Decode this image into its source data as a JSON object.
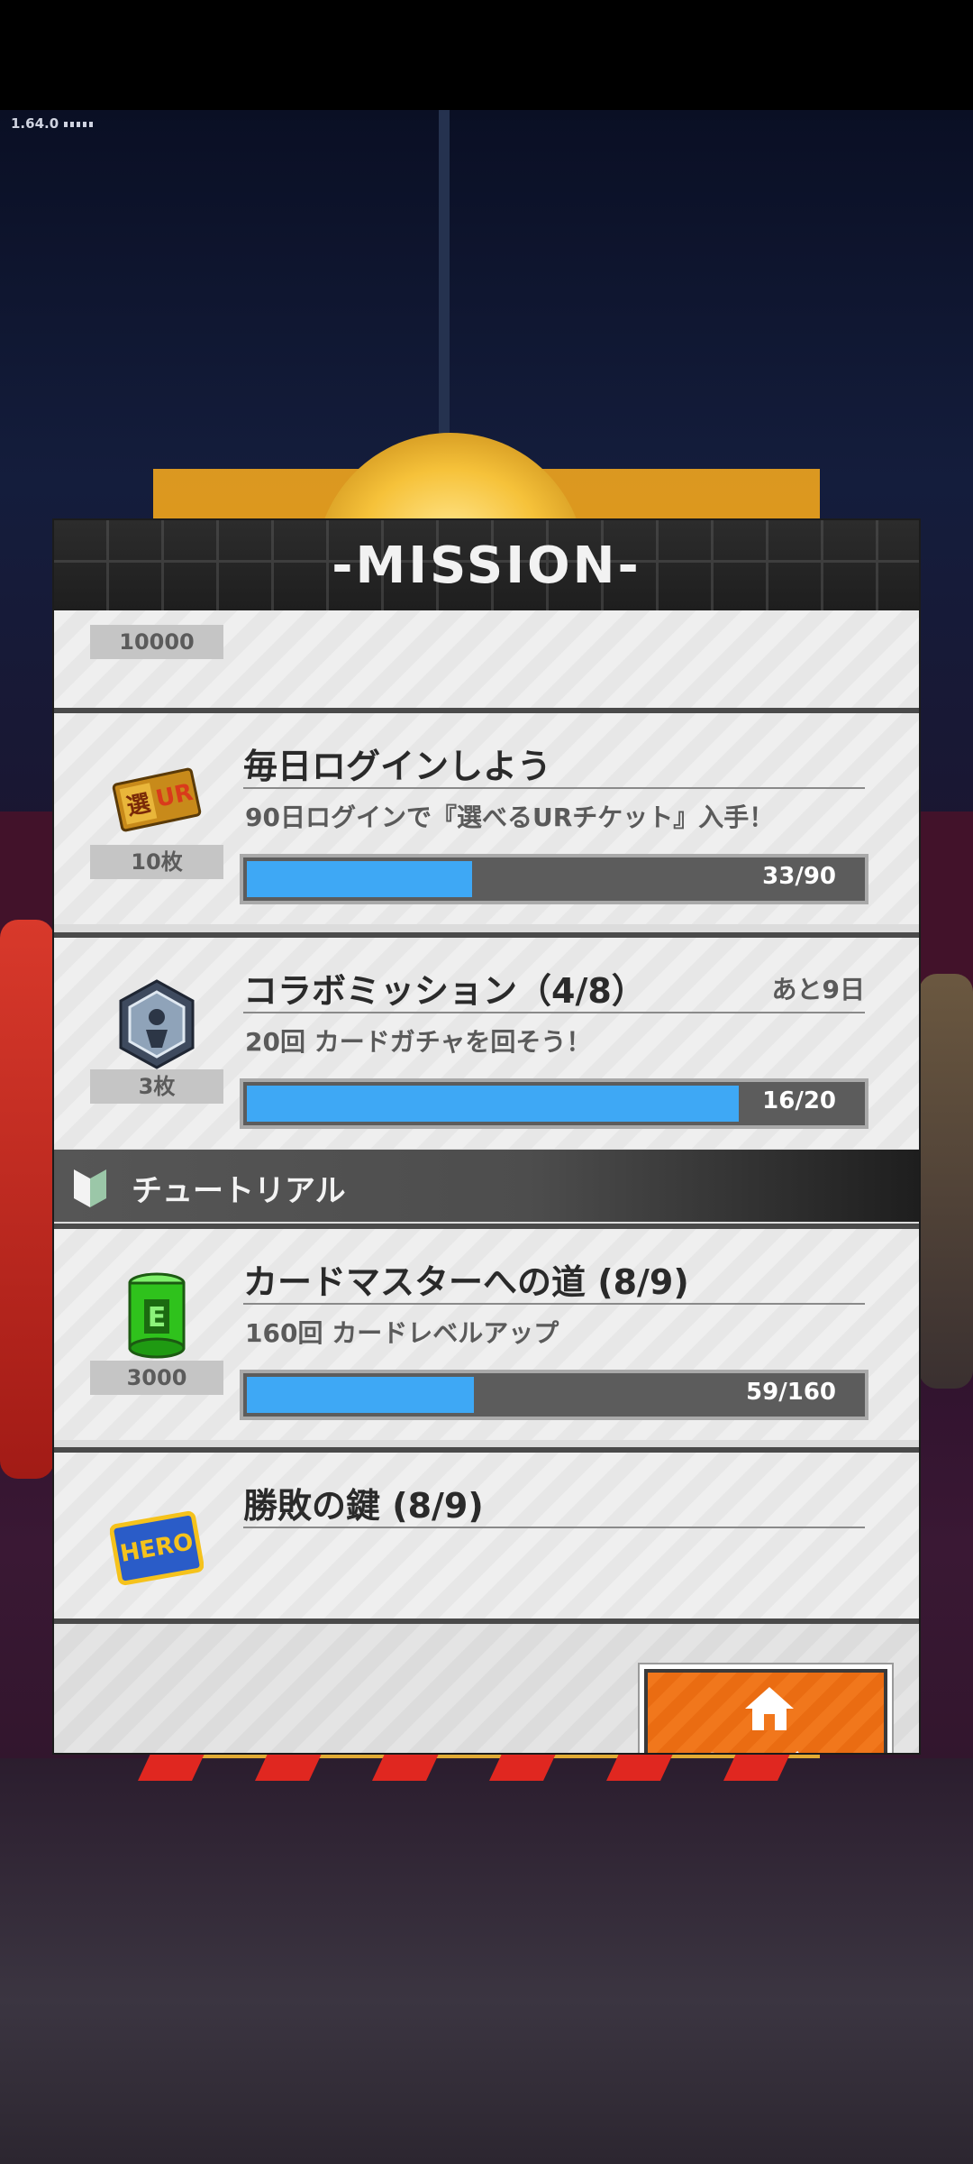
{
  "status": {
    "version": "1.64.0"
  },
  "panel": {
    "title": "-MISSION-"
  },
  "missions_top_partial": {
    "quantity": "10000"
  },
  "missions": [
    {
      "title": "毎日ログインしよう",
      "subtitle": "90日ログインで『選べるURチケット』入手！",
      "quantity": "10枚",
      "progress_text": "33/90",
      "progress": 0.367,
      "remaining": "",
      "icon": "ur-ticket-icon"
    },
    {
      "title": "コラボミッション（4/8）",
      "subtitle": "20回 カードガチャを回そう！",
      "quantity": "3枚",
      "progress_text": "16/20",
      "progress": 0.8,
      "remaining": "あと9日",
      "icon": "collab-medal-icon"
    }
  ],
  "section": {
    "label": "チュートリアル"
  },
  "tutorial_missions": [
    {
      "title": "カードマスターへの道 (8/9)",
      "subtitle": "160回 カードレベルアップ",
      "quantity": "3000",
      "progress_text": "59/160",
      "progress": 0.369,
      "icon": "green-energy-can-icon"
    },
    {
      "title": "勝敗の鍵 (8/9)",
      "icon": "hero-badge-icon"
    }
  ],
  "footer": {
    "home_label": "ホームに戻る"
  },
  "colors": {
    "progress": "#3ea8f5",
    "home_button": "#f1771c"
  }
}
